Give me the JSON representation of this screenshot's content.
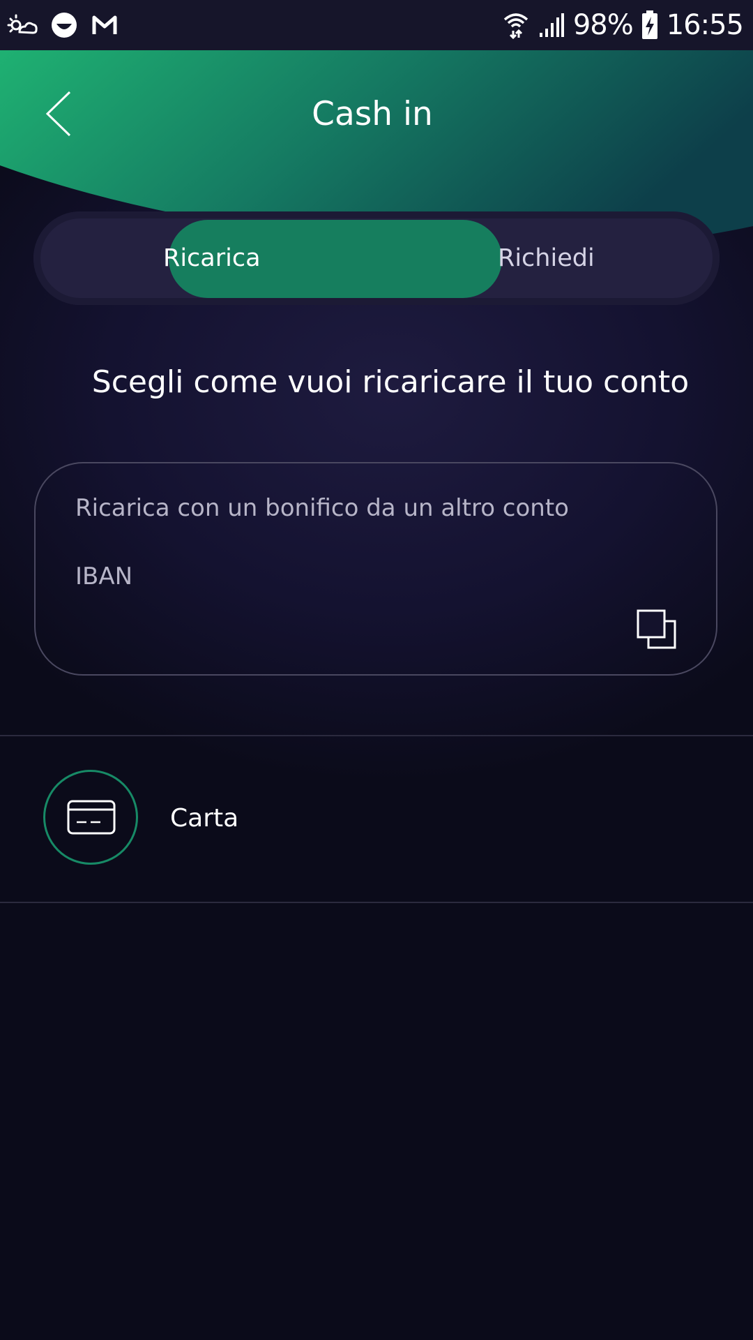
{
  "status_bar": {
    "left_icons": [
      "weather-icon",
      "app-icon",
      "gmail-icon"
    ],
    "right_icons": [
      "wifi-icon",
      "signal-icon",
      "battery-charging-icon"
    ],
    "battery_percent": "98%",
    "time": "16:55"
  },
  "header": {
    "title": "Cash in",
    "back_icon": "chevron-left-icon",
    "gradient_colors": [
      "#1fb172",
      "#0d3f4a"
    ]
  },
  "tabs": [
    {
      "label": "Ricarica",
      "active": true
    },
    {
      "label": "Richiedi",
      "active": false
    }
  ],
  "main": {
    "heading": "Scegli come vuoi ricaricare il tuo conto",
    "iban_card": {
      "description": "Ricarica con un bonifico da un altro conto",
      "label": "IBAN",
      "copy_icon": "copy-icon"
    },
    "options": [
      {
        "label": "Carta",
        "icon": "credit-card-icon"
      }
    ]
  },
  "colors": {
    "accent": "#167e5e",
    "background": "#0b0b1a",
    "status_bar": "#16152a"
  }
}
